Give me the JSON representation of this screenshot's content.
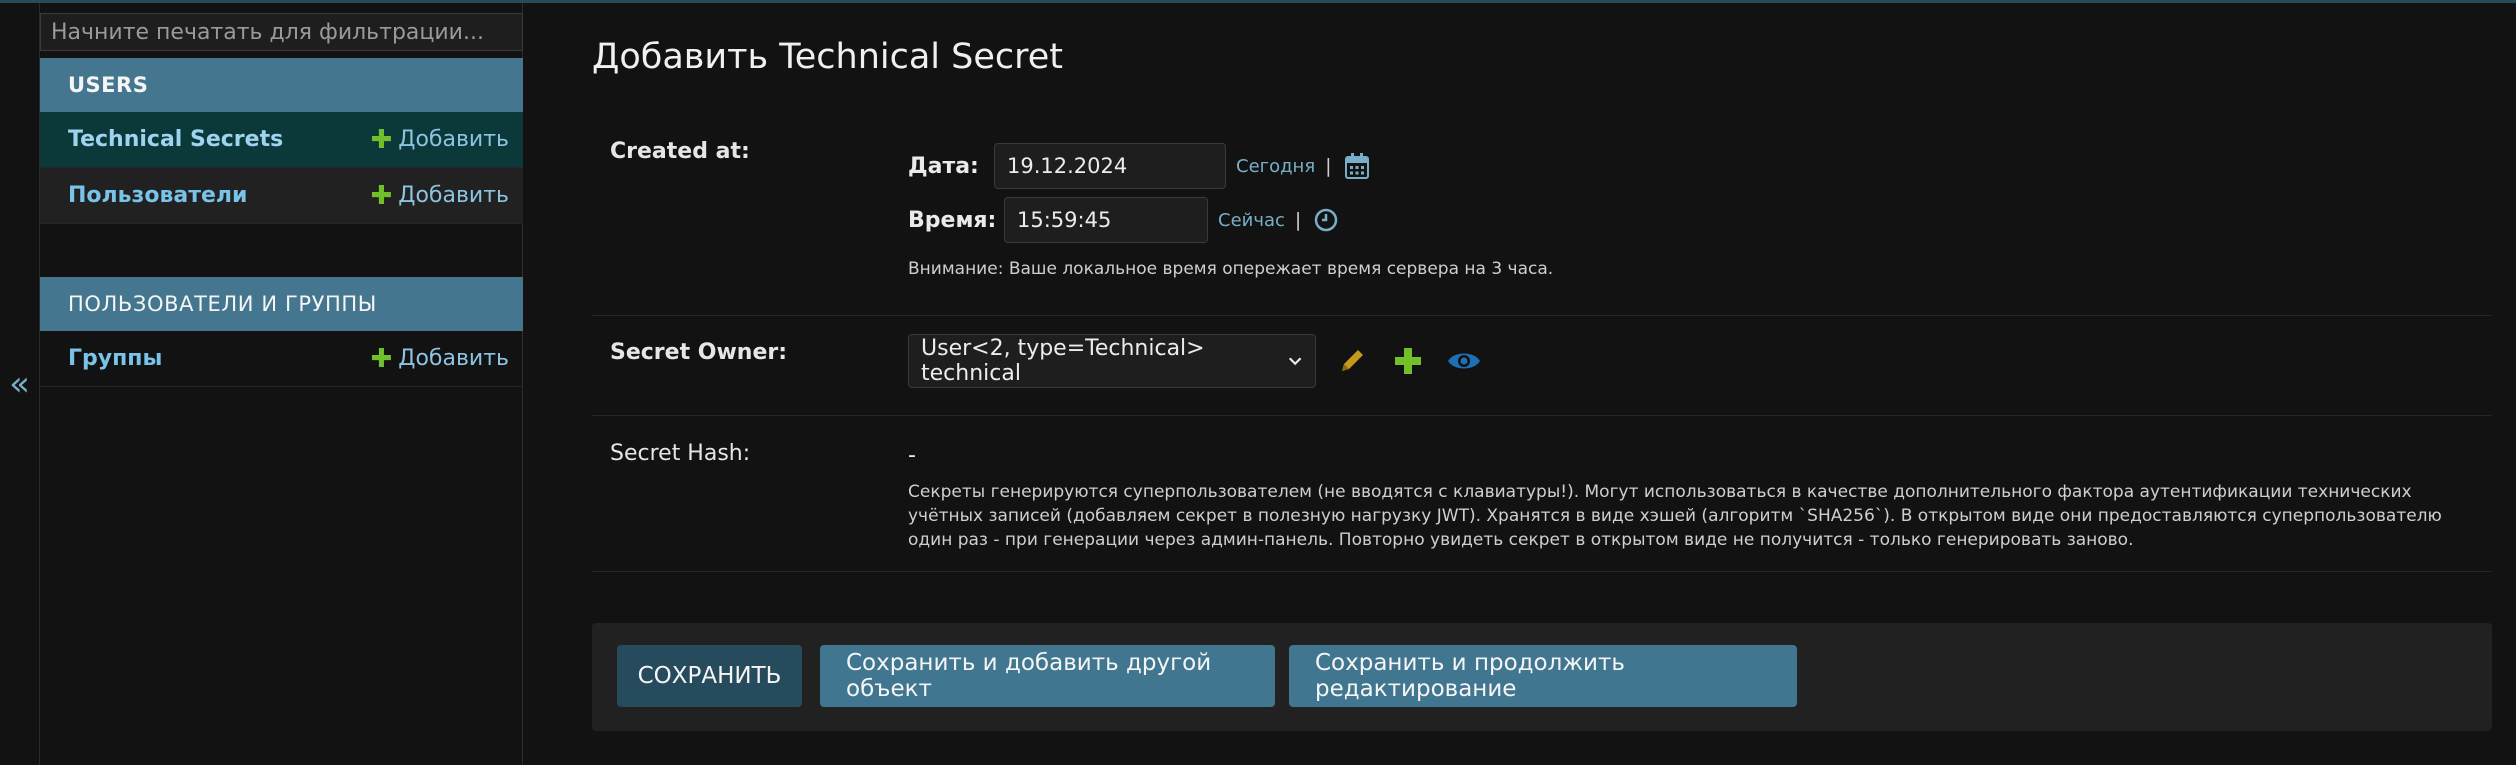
{
  "sidebar": {
    "filter_placeholder": "Начните печатать для фильтрации...",
    "modules": [
      {
        "caption": "USERS",
        "items": [
          {
            "label": "Technical Secrets",
            "add": "Добавить"
          },
          {
            "label": "Пользователи",
            "add": "Добавить"
          }
        ]
      },
      {
        "caption": "ПОЛЬЗОВАТЕЛИ И ГРУППЫ",
        "items": [
          {
            "label": "Группы",
            "add": "Добавить"
          }
        ]
      }
    ],
    "collapse_icon": "«"
  },
  "page": {
    "title": "Добавить Technical Secret"
  },
  "form": {
    "created_at": {
      "label": "Created at:",
      "date_label": "Дата:",
      "date_value": "19.12.2024",
      "today_link": "Сегодня",
      "time_label": "Время:",
      "time_value": "15:59:45",
      "now_link": "Сейчас",
      "separator": "|",
      "timezone_warning": "Внимание: Ваше локальное время опережает время сервера на 3 часа."
    },
    "secret_owner": {
      "label": "Secret Owner:",
      "selected": "User<2, type=Technical> technical"
    },
    "secret_hash": {
      "label": "Secret Hash:",
      "value": "-",
      "help": "Секреты генерируются суперпользователем (не вводятся с клавиатуры!). Могут использоваться в качестве дополнительного фактора аутентификации технических учётных записей (добавляем секрет в полезную нагрузку JWT). Хранятся в виде хэшей (алгоритм `SHA256`). В открытом виде они предоставляются суперпользователю один раз - при генерации через админ-панель. Повторно увидеть секрет в открытом виде не получится - только генерировать заново."
    }
  },
  "submit": {
    "save": "СОХРАНИТЬ",
    "save_add_another": "Сохранить и добавить другой объект",
    "save_continue": "Сохранить и продолжить редактирование"
  },
  "colors": {
    "accent": "#79aec8",
    "module_caption": "#44778f",
    "primary_button": "#264b5d",
    "secondary_button": "#417690",
    "add_plus": "#70bf2b",
    "edit_pencil": "#c59a1c"
  }
}
